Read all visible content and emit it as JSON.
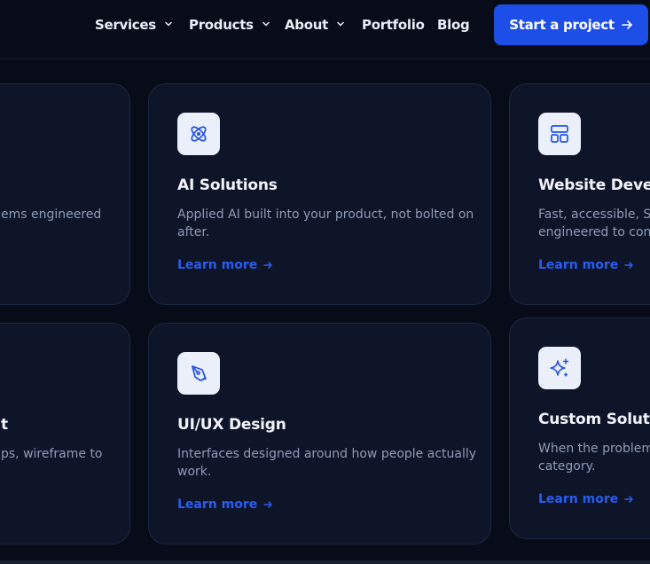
{
  "nav": {
    "items": [
      {
        "label": "Services",
        "dropdown": true
      },
      {
        "label": "Products",
        "dropdown": true
      },
      {
        "label": "About",
        "dropdown": true
      },
      {
        "label": "Portfolio",
        "dropdown": false
      },
      {
        "label": "Blog",
        "dropdown": false
      }
    ],
    "cta_label": "Start a project"
  },
  "cards": {
    "left_top": {
      "desc": "ems engineered"
    },
    "ai": {
      "icon": "atom-icon",
      "title": "AI Solutions",
      "desc_line1": "Applied AI built into your product, not bolted on",
      "desc_line2": "after.",
      "link": "Learn more"
    },
    "web": {
      "icon": "layout-icon",
      "title": "Website Develo",
      "desc_line1": "Fast, accessible, SE",
      "desc_line2": "engineered to conv",
      "link": "Learn more"
    },
    "left_bottom": {
      "title": "t",
      "desc": "ps, wireframe to"
    },
    "uiux": {
      "icon": "pen-tool-icon",
      "title": "UI/UX Design",
      "desc_line1": "Interfaces designed around how people actually",
      "desc_line2": "work.",
      "link": "Learn more"
    },
    "custom": {
      "icon": "sparkles-icon",
      "title": "Custom Solutio",
      "desc_line1": "When the problem",
      "desc_line2": "category.",
      "link": "Learn more"
    }
  },
  "colors": {
    "background": "#080c18",
    "card": "#0e1529",
    "accent": "#1d4ee8",
    "link": "#2a5cf0"
  }
}
